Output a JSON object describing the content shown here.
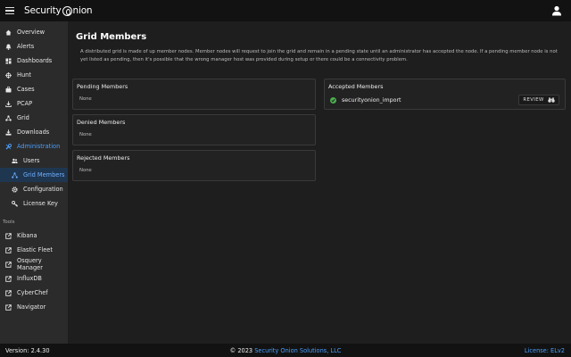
{
  "header": {
    "brand_left": "Security",
    "brand_right": "nion",
    "menu_icon": "hamburger-icon",
    "user_icon": "account-icon"
  },
  "sidebar": {
    "items": [
      {
        "label": "Overview",
        "icon": "home-icon"
      },
      {
        "label": "Alerts",
        "icon": "bell-icon"
      },
      {
        "label": "Dashboards",
        "icon": "dashboard-icon"
      },
      {
        "label": "Hunt",
        "icon": "crosshair-icon"
      },
      {
        "label": "Cases",
        "icon": "briefcase-icon"
      },
      {
        "label": "PCAP",
        "icon": "download-icon"
      },
      {
        "label": "Grid",
        "icon": "grid-icon"
      },
      {
        "label": "Downloads",
        "icon": "download-tray-icon"
      },
      {
        "label": "Administration",
        "icon": "tools-icon"
      }
    ],
    "admin_sub": [
      {
        "label": "Users",
        "icon": "users-icon"
      },
      {
        "label": "Grid Members",
        "icon": "network-icon"
      },
      {
        "label": "Configuration",
        "icon": "gear-icon"
      },
      {
        "label": "License Key",
        "icon": "key-icon"
      }
    ],
    "tools_label": "Tools",
    "tools": [
      {
        "label": "Kibana",
        "icon": "external-link-icon"
      },
      {
        "label": "Elastic Fleet",
        "icon": "external-link-icon"
      },
      {
        "label": "Osquery Manager",
        "icon": "external-link-icon"
      },
      {
        "label": "InfluxDB",
        "icon": "external-link-icon"
      },
      {
        "label": "CyberChef",
        "icon": "external-link-icon"
      },
      {
        "label": "Navigator",
        "icon": "external-link-icon"
      }
    ]
  },
  "main": {
    "title": "Grid Members",
    "description": "A distributed grid is made of up member nodes. Member nodes will request to join the grid and remain in a pending state until an administrator has accepted the node. If a pending member node is not yet listed as pending, then it's possible that the wrong manager host was provided during setup or there could be a connectivity problem.",
    "pending": {
      "title": "Pending Members",
      "empty": "None"
    },
    "denied": {
      "title": "Denied Members",
      "empty": "None"
    },
    "rejected": {
      "title": "Rejected Members",
      "empty": "None"
    },
    "accepted": {
      "title": "Accepted Members",
      "members": [
        {
          "name": "securityonion_import",
          "action": "REVIEW"
        }
      ]
    }
  },
  "footer": {
    "version": "Version: 2.4.30",
    "copyright_prefix": "© 2023 ",
    "copyright_link": "Security Onion Solutions, LLC",
    "license": "License: ELv2"
  },
  "colors": {
    "accent": "#4a9fff",
    "success": "#4caf50",
    "topbar": "#121212",
    "sidebar": "#2b2b2b",
    "background": "#1e1e1e"
  }
}
